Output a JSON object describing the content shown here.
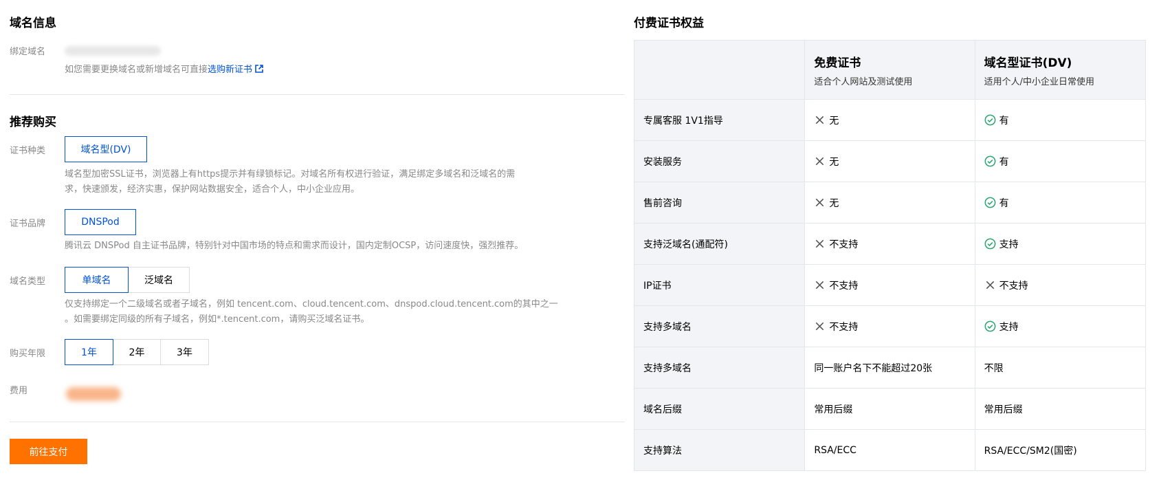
{
  "domain_info": {
    "title": "域名信息",
    "bind_label": "绑定域名",
    "hint_prefix": "如您需要更换域名或新增域名可直接",
    "hint_link": "选购新证书"
  },
  "recommend": {
    "title": "推荐购买",
    "cert_type": {
      "label": "证书种类",
      "options": [
        "域名型(DV)"
      ],
      "selected": "域名型(DV)",
      "desc_line1": "域名型加密SSL证书，浏览器上有https提示并有绿锁标记。对域名所有权进行验证，满足绑定多域名和泛域名的需",
      "desc_line2": "求，快速颁发，经济实惠，保护网站数据安全，适合个人，中小企业应用。"
    },
    "brand": {
      "label": "证书品牌",
      "options": [
        "DNSPod"
      ],
      "selected": "DNSPod",
      "desc": "腾讯云 DNSPod 自主证书品牌，特别针对中国市场的特点和需求而设计，国内定制OCSP，访问速度快，强烈推荐。"
    },
    "domain_type": {
      "label": "域名类型",
      "options": [
        "单域名",
        "泛域名"
      ],
      "selected": "单域名",
      "desc_line1": "仅支持绑定一个二级域名或者子域名，例如 tencent.com、cloud.tencent.com、dnspod.cloud.tencent.com的其中之一",
      "desc_line2": "。如需要绑定同级的所有子域名，例如*.tencent.com，请购买泛域名证书。"
    },
    "years": {
      "label": "购买年限",
      "options": [
        "1年",
        "2年",
        "3年"
      ],
      "selected": "1年"
    },
    "fee_label": "费用",
    "pay_button": "前往支付"
  },
  "benefits": {
    "title": "付费证书权益",
    "columns": [
      {
        "title": "免费证书",
        "sub": "适合个人网站及测试使用"
      },
      {
        "title": "域名型证书(DV)",
        "sub": "适用个人/中小企业日常使用"
      }
    ],
    "rows": [
      {
        "feature": "专属客服 1V1指导",
        "free": {
          "mark": "cross",
          "text": "无"
        },
        "dv": {
          "mark": "check",
          "text": "有"
        }
      },
      {
        "feature": "安装服务",
        "free": {
          "mark": "cross",
          "text": "无"
        },
        "dv": {
          "mark": "check",
          "text": "有"
        }
      },
      {
        "feature": "售前咨询",
        "free": {
          "mark": "cross",
          "text": "无"
        },
        "dv": {
          "mark": "check",
          "text": "有"
        }
      },
      {
        "feature": "支持泛域名(通配符)",
        "free": {
          "mark": "cross",
          "text": "不支持"
        },
        "dv": {
          "mark": "check",
          "text": "支持"
        }
      },
      {
        "feature": "IP证书",
        "free": {
          "mark": "cross",
          "text": "不支持"
        },
        "dv": {
          "mark": "cross",
          "text": "不支持"
        }
      },
      {
        "feature": "支持多域名",
        "free": {
          "mark": "cross",
          "text": "不支持"
        },
        "dv": {
          "mark": "check",
          "text": "支持"
        }
      },
      {
        "feature": "支持多域名",
        "free": {
          "mark": "none",
          "text": "同一账户名下不能超过20张"
        },
        "dv": {
          "mark": "none",
          "text": "不限"
        }
      },
      {
        "feature": "域名后缀",
        "free": {
          "mark": "none",
          "text": "常用后缀"
        },
        "dv": {
          "mark": "none",
          "text": "常用后缀"
        }
      },
      {
        "feature": "支持算法",
        "free": {
          "mark": "none",
          "text": "RSA/ECC"
        },
        "dv": {
          "mark": "none",
          "text": "RSA/ECC/SM2(国密)"
        }
      }
    ]
  },
  "colors": {
    "accent": "#0052d9",
    "pay": "#ff7200",
    "check": "#2ba471",
    "cross": "#555555"
  },
  "icons": {
    "external_link": "external-link-icon",
    "check": "check-circle-icon",
    "cross": "close-icon"
  }
}
